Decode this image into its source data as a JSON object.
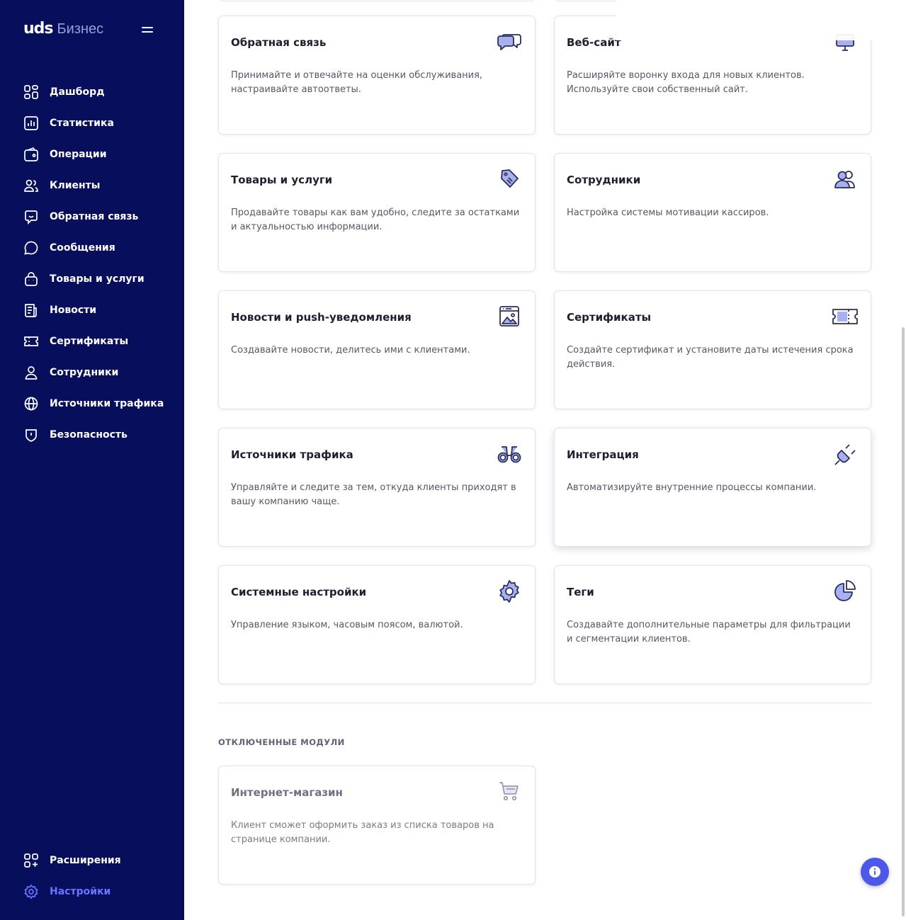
{
  "app": {
    "logo": "uds",
    "logo_sub": "Бизнес"
  },
  "sidebar": {
    "items": [
      {
        "label": "Дашборд",
        "icon": "dashboard-icon"
      },
      {
        "label": "Статистика",
        "icon": "statistics-icon"
      },
      {
        "label": "Операции",
        "icon": "operations-icon"
      },
      {
        "label": "Клиенты",
        "icon": "clients-icon"
      },
      {
        "label": "Обратная связь",
        "icon": "feedback-icon"
      },
      {
        "label": "Сообщения",
        "icon": "messages-icon"
      },
      {
        "label": "Товары и услуги",
        "icon": "bag-icon"
      },
      {
        "label": "Новости",
        "icon": "news-icon"
      },
      {
        "label": "Сертификаты",
        "icon": "ticket-icon"
      },
      {
        "label": "Сотрудники",
        "icon": "user-icon"
      },
      {
        "label": "Источники трафика",
        "icon": "globe-icon"
      },
      {
        "label": "Безопасность",
        "icon": "shield-icon"
      }
    ],
    "bottom": [
      {
        "label": "Расширения",
        "icon": "extensions-icon"
      },
      {
        "label": "Настройки",
        "icon": "settings-icon",
        "active": true
      }
    ],
    "colors": {
      "background": "#070f5c",
      "active": "#6b74ff"
    }
  },
  "modules": [
    {
      "title": "Обратная связь",
      "description": "Принимайте и отвечайте на оценки обслуживания, настраивайте автоответы.",
      "icon": "chat-bubbles-icon"
    },
    {
      "title": "Веб-сайт",
      "description": "Расширяйте воронку входа для новых клиентов. Используйте свои собственный сайт.",
      "icon": "monitor-icon"
    },
    {
      "title": "Товары и услуги",
      "description": "Продавайте товары как вам удобно, следите за остатками и актуальностью информации.",
      "icon": "price-tag-icon"
    },
    {
      "title": "Сотрудники",
      "description": "Настройка системы мотивации кассиров.",
      "icon": "employees-icon"
    },
    {
      "title": "Новости и push-уведомления",
      "description": "Создавайте новости, делитесь ими с клиентами.",
      "icon": "image-window-icon"
    },
    {
      "title": "Сертификаты",
      "description": "Создайте сертификат и установите даты истечения срока действия.",
      "icon": "certificate-ticket-icon"
    },
    {
      "title": "Источники трафика",
      "description": "Управляйте и следите за тем, откуда клиенты приходят в вашу компанию чаще.",
      "icon": "binoculars-icon"
    },
    {
      "title": "Интеграция",
      "description": "Автоматизируйте внутренние процессы компании.",
      "icon": "plug-icon"
    },
    {
      "title": "Системные настройки",
      "description": "Управление языком, часовым поясом, валютой.",
      "icon": "gear-icon"
    },
    {
      "title": "Теги",
      "description": "Создавайте дополнительные параметры для фильтрации и сегментации клиентов.",
      "icon": "pie-chart-icon"
    }
  ],
  "disabled_section": {
    "title": "ОТКЛЮЧЕННЫЕ МОДУЛИ",
    "modules": [
      {
        "title": "Интернет-магазин",
        "description": "Клиент сможет оформить заказ из списка товаров на странице компании.",
        "icon": "cart-icon"
      }
    ]
  },
  "colors": {
    "accent": "#4e58e8",
    "icon_fill": "#a9b0f2",
    "icon_stroke": "#2b2f5a"
  }
}
